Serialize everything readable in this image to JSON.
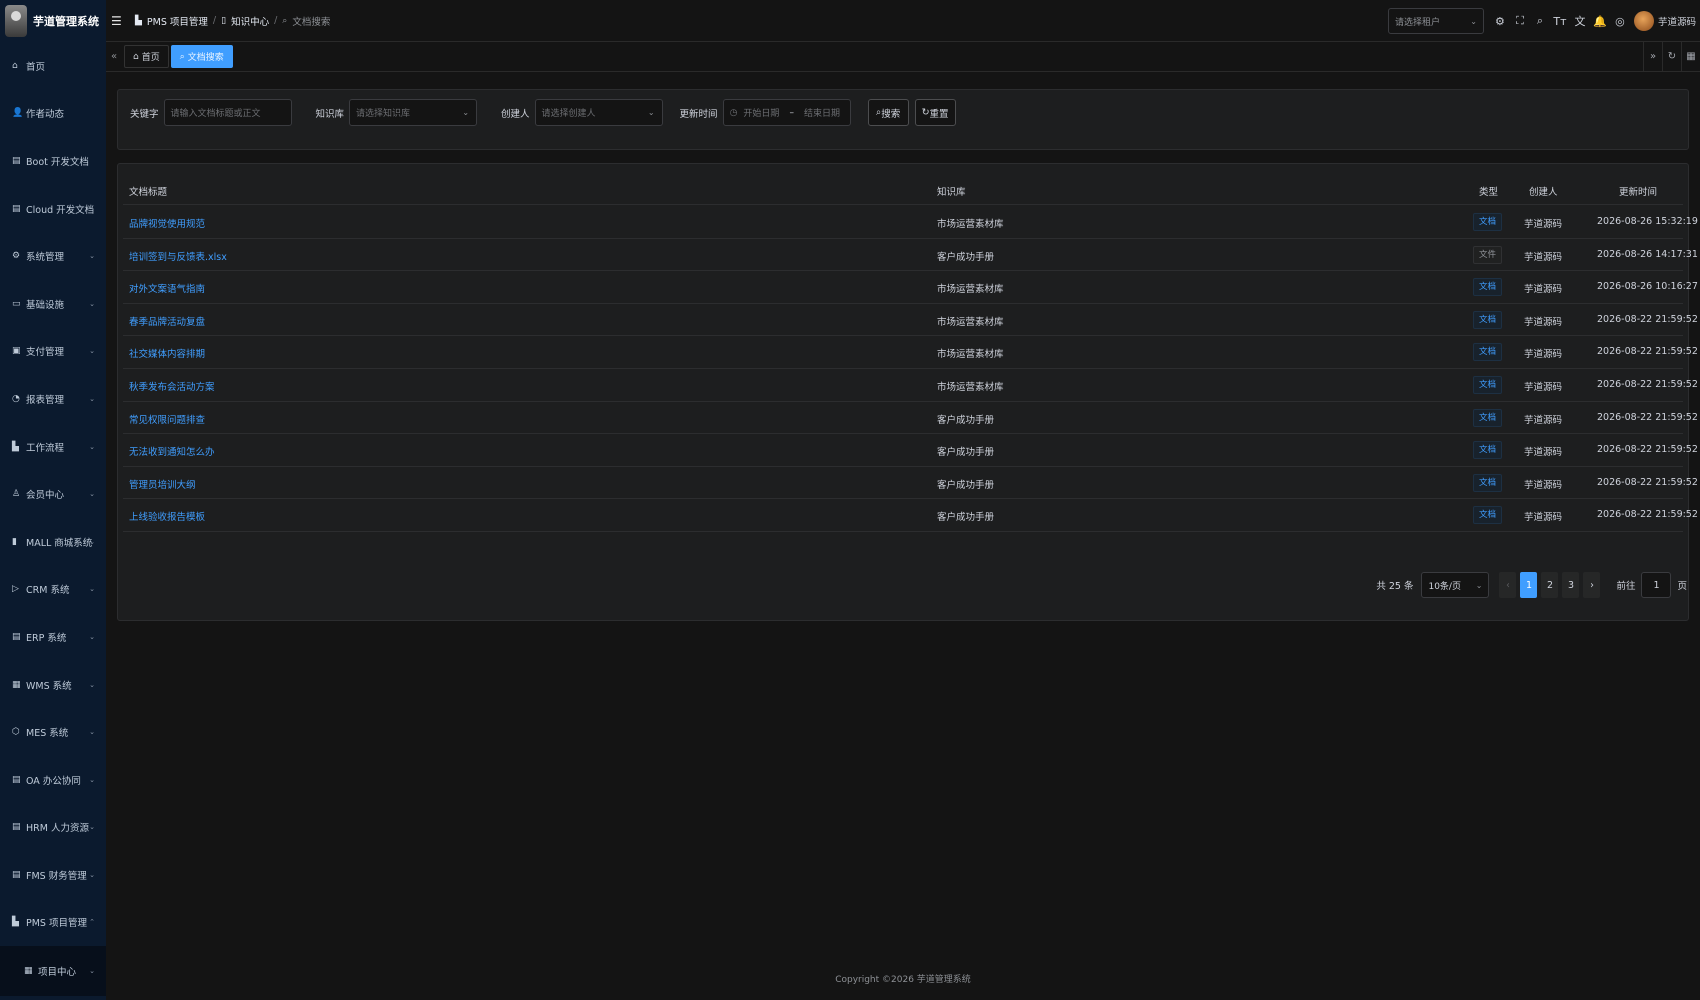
{
  "app": {
    "title": "芋道管理系统"
  },
  "sidebar": {
    "items": [
      {
        "label": "首页",
        "icon": "home-icon",
        "glyph": "⌂",
        "chevron": ""
      },
      {
        "label": "作者动态",
        "icon": "user-icon",
        "glyph": "👤",
        "chevron": ""
      },
      {
        "label": "Boot 开发文档",
        "icon": "document-icon",
        "glyph": "▤",
        "chevron": ""
      },
      {
        "label": "Cloud 开发文档",
        "icon": "document-icon",
        "glyph": "▤",
        "chevron": ""
      },
      {
        "label": "系统管理",
        "icon": "gear-icon",
        "glyph": "⚙",
        "chevron": "⌄"
      },
      {
        "label": "基础设施",
        "icon": "monitor-icon",
        "glyph": "▭",
        "chevron": "⌄"
      },
      {
        "label": "支付管理",
        "icon": "payment-icon",
        "glyph": "▣",
        "chevron": "⌄"
      },
      {
        "label": "报表管理",
        "icon": "chart-icon",
        "glyph": "◔",
        "chevron": "⌄"
      },
      {
        "label": "工作流程",
        "icon": "workflow-icon",
        "glyph": "▙",
        "chevron": "⌄"
      },
      {
        "label": "会员中心",
        "icon": "member-icon",
        "glyph": "♙",
        "chevron": "⌄"
      },
      {
        "label": "MALL 商城系统",
        "icon": "mall-icon",
        "glyph": "▮",
        "chevron": "⌄"
      },
      {
        "label": "CRM 系统",
        "icon": "crm-icon",
        "glyph": "▷",
        "chevron": "⌄"
      },
      {
        "label": "ERP 系统",
        "icon": "erp-icon",
        "glyph": "▤",
        "chevron": "⌄"
      },
      {
        "label": "WMS 系统",
        "icon": "wms-icon",
        "glyph": "▦",
        "chevron": "⌄"
      },
      {
        "label": "MES 系统",
        "icon": "mes-icon",
        "glyph": "⬡",
        "chevron": "⌄"
      },
      {
        "label": "OA 办公协同",
        "icon": "oa-icon",
        "glyph": "▤",
        "chevron": "⌄"
      },
      {
        "label": "HRM 人力资源",
        "icon": "hrm-icon",
        "glyph": "▤",
        "chevron": "⌄"
      },
      {
        "label": "FMS 财务管理",
        "icon": "finance-icon",
        "glyph": "▤",
        "chevron": "⌄"
      },
      {
        "label": "PMS 项目管理",
        "icon": "project-icon",
        "glyph": "▙",
        "chevron": "⌃"
      }
    ],
    "sub_item": {
      "label": "项目中心",
      "icon": "grid-icon",
      "glyph": "▦",
      "chevron": "⌄"
    }
  },
  "breadcrumb": {
    "items": [
      "PMS 项目管理",
      "知识中心",
      "文档搜索"
    ],
    "separator": "/"
  },
  "header": {
    "tenant_placeholder": "请选择租户",
    "username": "芋道源码"
  },
  "tabs": [
    {
      "label": "首页"
    },
    {
      "label": "文档搜索"
    }
  ],
  "filter": {
    "keyword_label": "关键字",
    "keyword_placeholder": "请输入文档标题或正文",
    "kb_label": "知识库",
    "kb_placeholder": "请选择知识库",
    "creator_label": "创建人",
    "creator_placeholder": "请选择创建人",
    "time_label": "更新时间",
    "start_placeholder": "开始日期",
    "range_sep": "–",
    "end_placeholder": "结束日期",
    "search_label": "搜索",
    "reset_label": "重置"
  },
  "table": {
    "headers": {
      "title": "文档标题",
      "kb": "知识库",
      "type": "类型",
      "creator": "创建人",
      "time": "更新时间"
    },
    "rows": [
      {
        "title": "品牌视觉使用规范",
        "kb": "市场运营素材库",
        "type": "文档",
        "type_kind": "doc",
        "creator": "芋道源码",
        "time": "2026-08-26 15:32:19"
      },
      {
        "title": "培训签到与反馈表.xlsx",
        "kb": "客户成功手册",
        "type": "文件",
        "type_kind": "file",
        "creator": "芋道源码",
        "time": "2026-08-26 14:17:31"
      },
      {
        "title": "对外文案语气指南",
        "kb": "市场运营素材库",
        "type": "文档",
        "type_kind": "doc",
        "creator": "芋道源码",
        "time": "2026-08-26 10:16:27"
      },
      {
        "title": "春季品牌活动复盘",
        "kb": "市场运营素材库",
        "type": "文档",
        "type_kind": "doc",
        "creator": "芋道源码",
        "time": "2026-08-22 21:59:52"
      },
      {
        "title": "社交媒体内容排期",
        "kb": "市场运营素材库",
        "type": "文档",
        "type_kind": "doc",
        "creator": "芋道源码",
        "time": "2026-08-22 21:59:52"
      },
      {
        "title": "秋季发布会活动方案",
        "kb": "市场运营素材库",
        "type": "文档",
        "type_kind": "doc",
        "creator": "芋道源码",
        "time": "2026-08-22 21:59:52"
      },
      {
        "title": "常见权限问题排查",
        "kb": "客户成功手册",
        "type": "文档",
        "type_kind": "doc",
        "creator": "芋道源码",
        "time": "2026-08-22 21:59:52"
      },
      {
        "title": "无法收到通知怎么办",
        "kb": "客户成功手册",
        "type": "文档",
        "type_kind": "doc",
        "creator": "芋道源码",
        "time": "2026-08-22 21:59:52"
      },
      {
        "title": "管理员培训大纲",
        "kb": "客户成功手册",
        "type": "文档",
        "type_kind": "doc",
        "creator": "芋道源码",
        "time": "2026-08-22 21:59:52"
      },
      {
        "title": "上线验收报告模板",
        "kb": "客户成功手册",
        "type": "文档",
        "type_kind": "doc",
        "creator": "芋道源码",
        "time": "2026-08-22 21:59:52"
      }
    ]
  },
  "pagination": {
    "total_text": "共 25 条",
    "page_size": "10条/页",
    "pages": [
      "1",
      "2",
      "3"
    ],
    "current": "1",
    "prev": "‹",
    "next": "›",
    "goto_label": "前往",
    "goto_value": "1",
    "goto_suffix": "页"
  },
  "footer": {
    "copyright": "Copyright ©2026 芋道管理系统"
  },
  "colors": {
    "accent": "#409eff",
    "sidebar_bg": "#0b1a2e",
    "page_bg": "#141414"
  }
}
